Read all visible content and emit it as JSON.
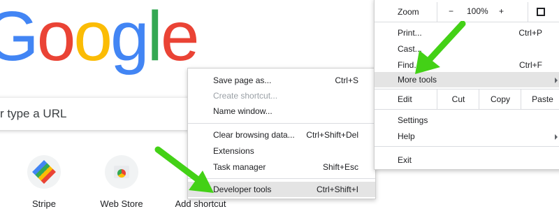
{
  "logo": {
    "letters": [
      {
        "ch": "G",
        "color": "#4285F4"
      },
      {
        "ch": "o",
        "color": "#EA4335"
      },
      {
        "ch": "o",
        "color": "#FBBC05"
      },
      {
        "ch": "g",
        "color": "#4285F4"
      },
      {
        "ch": "l",
        "color": "#34A853"
      },
      {
        "ch": "e",
        "color": "#EA4335"
      }
    ]
  },
  "search": {
    "placeholder": "r type a URL"
  },
  "shortcuts": [
    {
      "label": "Stripe",
      "icon": "stripe-logo"
    },
    {
      "label": "Web Store",
      "icon": "web-store-logo"
    },
    {
      "label": "Add shortcut",
      "icon": "plus-icon"
    }
  ],
  "submenu": {
    "items": [
      {
        "label": "Save page as...",
        "shortcut": "Ctrl+S"
      },
      {
        "label": "Create shortcut...",
        "shortcut": "",
        "disabled": true
      },
      {
        "label": "Name window...",
        "shortcut": ""
      },
      {
        "label": "Clear browsing data...",
        "shortcut": "Ctrl+Shift+Del"
      },
      {
        "label": "Extensions",
        "shortcut": ""
      },
      {
        "label": "Task manager",
        "shortcut": "Shift+Esc"
      },
      {
        "label": "Developer tools",
        "shortcut": "Ctrl+Shift+I",
        "highlighted": true
      }
    ]
  },
  "mainmenu": {
    "zoom": {
      "label": "Zoom",
      "minus": "−",
      "value": "100%",
      "plus": "+",
      "fullscreen_icon": "fullscreen-icon"
    },
    "items": [
      {
        "label": "Print...",
        "shortcut": "Ctrl+P"
      },
      {
        "label": "Cast...",
        "shortcut": ""
      },
      {
        "label": "Find...",
        "shortcut": "Ctrl+F"
      },
      {
        "label": "More tools",
        "shortcut": "",
        "highlighted": true,
        "submenu": true
      }
    ],
    "edit": {
      "label": "Edit",
      "cut": "Cut",
      "copy": "Copy",
      "paste": "Paste"
    },
    "items2": [
      {
        "label": "Settings"
      },
      {
        "label": "Help",
        "submenu": true
      }
    ],
    "exit": {
      "label": "Exit"
    }
  },
  "colors": {
    "pointer_arrow": "#43d116",
    "menu_highlight": "#e4e4e4"
  }
}
